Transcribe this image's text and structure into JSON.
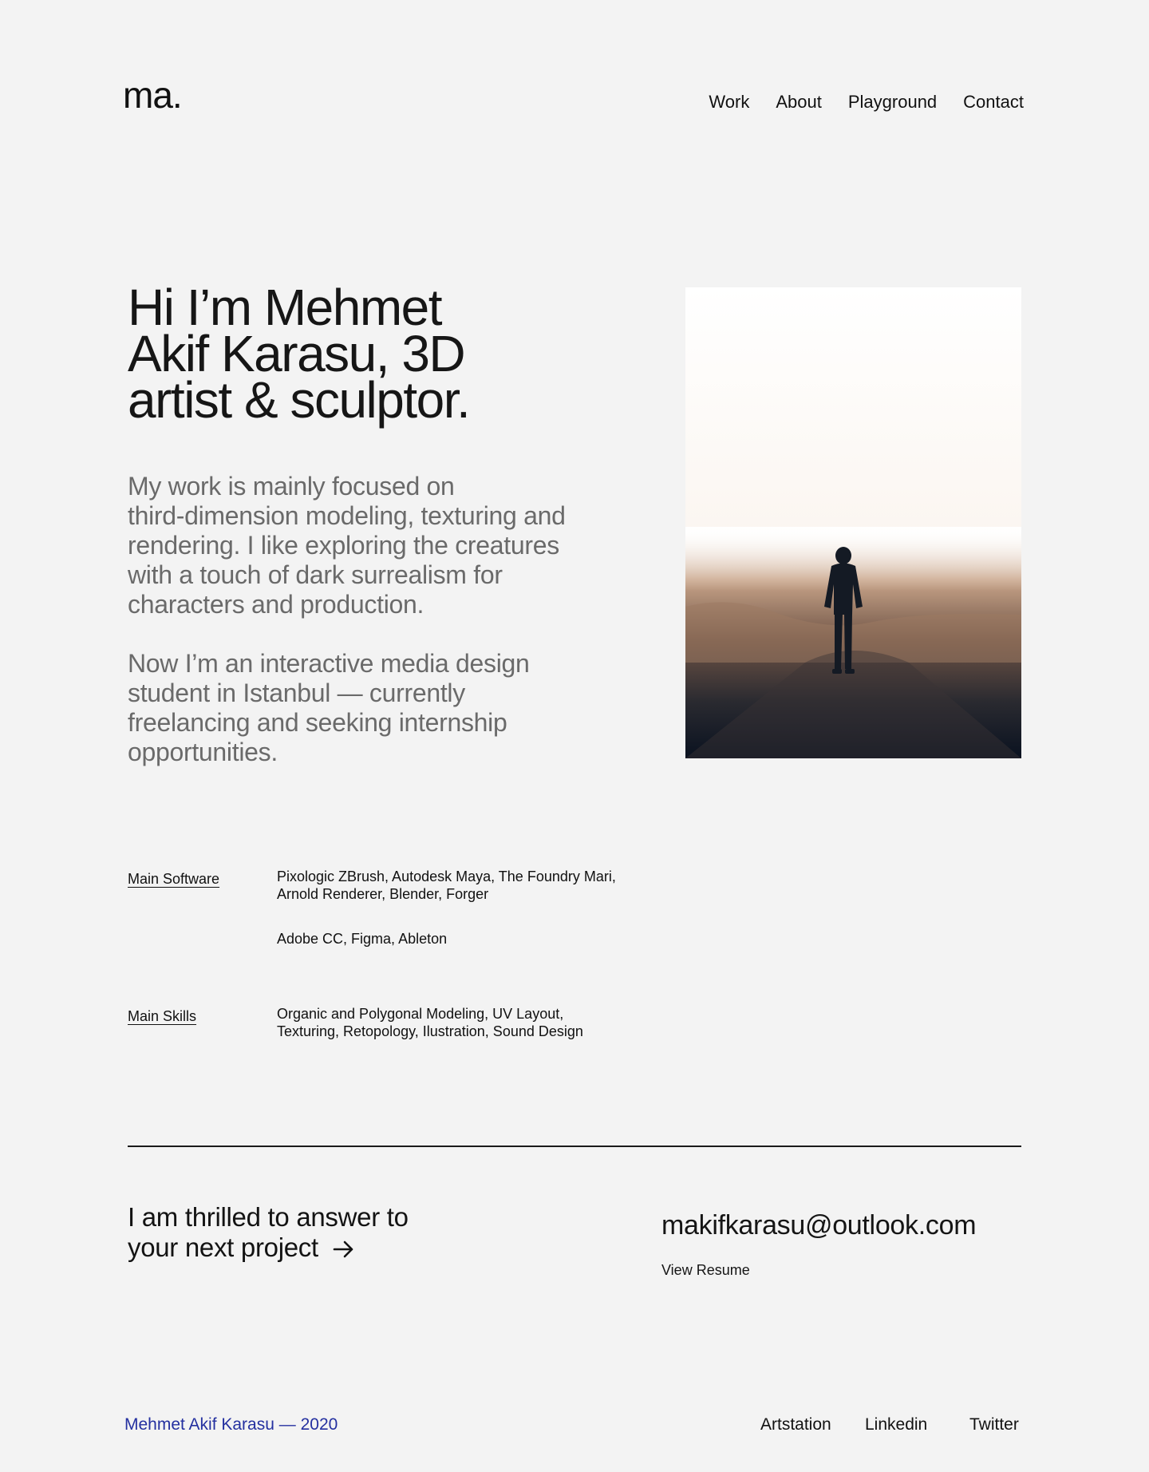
{
  "header": {
    "logo": "ma.",
    "nav": [
      "Work",
      "About",
      "Playground",
      "Contact"
    ]
  },
  "hero": {
    "title_lines": [
      "Hi I’m Mehmet",
      "Akif Karasu, 3D",
      "artist & sculptor."
    ],
    "bio_p1": [
      "My work is mainly focused on",
      "third-dimension modeling, texturing and",
      "rendering. I like exploring the creatures",
      "with a touch of dark surrealism for",
      "characters and production."
    ],
    "bio_p2": [
      "Now I’m an interactive media design",
      "student in Istanbul — currently",
      "freelancing and seeking internship",
      "opportunities."
    ]
  },
  "skills": {
    "software_label": "Main Software",
    "software_lines_1": [
      "Pixologic ZBrush, Autodesk Maya, The Foundry Mari,",
      "Arnold Renderer, Blender, Forger"
    ],
    "software_line_2": "Adobe CC, Figma, Ableton",
    "skills_label": "Main Skills",
    "skills_lines": [
      "Organic and Polygonal Modeling, UV Layout,",
      "Texturing, Retopology, Ilustration, Sound Design"
    ]
  },
  "contact": {
    "thrilled_lines": [
      "I am thrilled to answer to",
      "your next project"
    ],
    "email": "makifkarasu@outlook.com",
    "resume": "View Resume"
  },
  "footer": {
    "copyright": "Mehmet Akif Karasu — 2020",
    "social": [
      "Artstation",
      "Linkedin",
      "Twitter"
    ]
  },
  "colors": {
    "background": "#f3f3f3",
    "text": "#121212",
    "muted": "#6a6a6a",
    "accent": "#2430a0"
  },
  "icons": {
    "arrow": "arrow-right-icon"
  }
}
